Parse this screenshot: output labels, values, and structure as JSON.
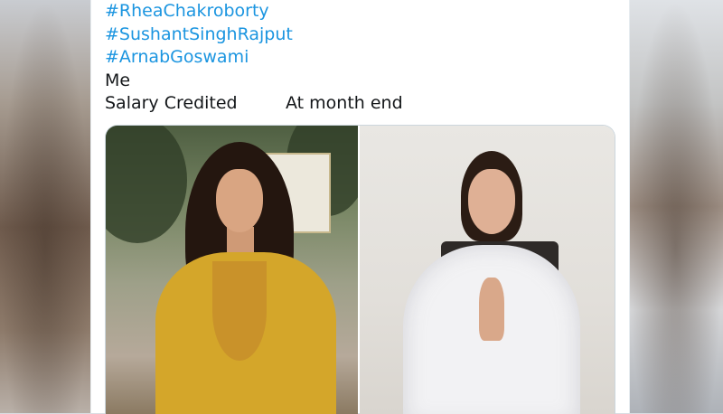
{
  "tweet": {
    "hashtags": [
      "#RheaChakroborty",
      "#SushantSinghRajput",
      "#ArnabGoswami"
    ],
    "line_me": "Me",
    "salary_left": "Salary Credited",
    "salary_right": "At month end"
  },
  "media": {
    "images": [
      {
        "icon": "photo-woman-yellow-dress"
      },
      {
        "icon": "photo-woman-white-dress-namaste"
      }
    ]
  },
  "colors": {
    "hashtag": "#1b95e0",
    "text": "#14171a",
    "card_bg": "#ffffff"
  }
}
